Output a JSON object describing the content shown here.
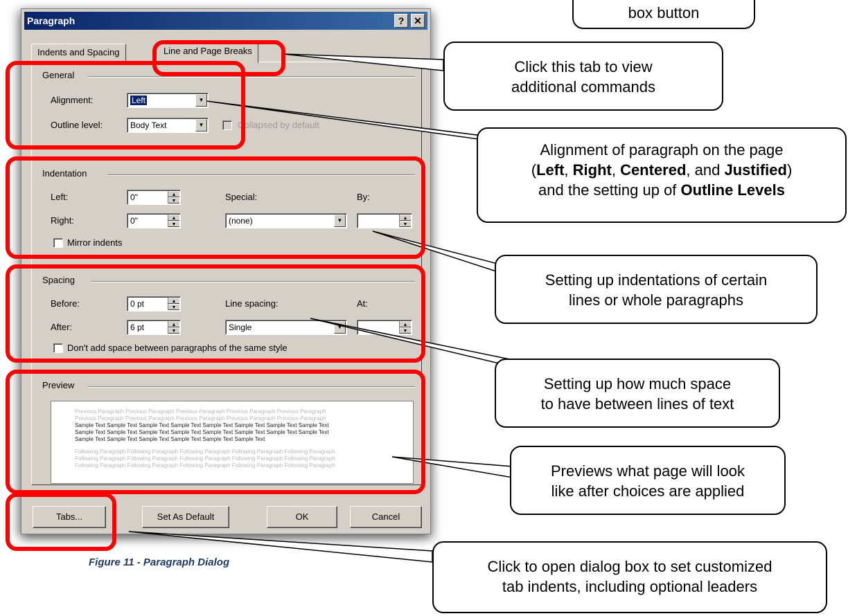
{
  "dialog": {
    "title": "Paragraph",
    "help_glyph": "?",
    "close_glyph": "✕",
    "tabs": [
      "Indents and Spacing",
      "Line and Page Breaks"
    ],
    "general": {
      "group_label": "General",
      "alignment_label": "Alignment:",
      "alignment_value": "Left",
      "outline_label": "Outline level:",
      "outline_value": "Body Text",
      "collapsed_label": "Collapsed by default"
    },
    "indentation": {
      "group_label": "Indentation",
      "left_label": "Left:",
      "left_value": "0\"",
      "right_label": "Right:",
      "right_value": "0\"",
      "special_label": "Special:",
      "special_value": "(none)",
      "by_label": "By:",
      "by_value": "",
      "mirror_label": "Mirror indents"
    },
    "spacing": {
      "group_label": "Spacing",
      "before_label": "Before:",
      "before_value": "0 pt",
      "after_label": "After:",
      "after_value": "6 pt",
      "line_spacing_label": "Line spacing:",
      "line_spacing_value": "Single",
      "at_label": "At:",
      "at_value": "",
      "dont_add_label": "Don't add space between paragraphs of the same style"
    },
    "preview": {
      "group_label": "Preview",
      "previous_lines": [
        "Previous Paragraph Previous Paragraph Previous Paragraph Previous Paragraph Previous Paragraph",
        "Previous Paragraph Previous Paragraph Previous Paragraph Previous Paragraph Previous Paragraph"
      ],
      "sample_lines": [
        "Sample Text Sample Text Sample Text Sample Text Sample Text Sample Text Sample Text Sample Text",
        "Sample Text Sample Text Sample Text Sample Text Sample Text Sample Text Sample Text Sample Text",
        "Sample Text Sample Text Sample Text Sample Text Sample Text Sample Text"
      ],
      "following_lines": [
        "Following Paragraph Following Paragraph Following Paragraph Following Paragraph Following Paragraph",
        "Following Paragraph Following Paragraph Following Paragraph Following Paragraph Following Paragraph",
        "Following Paragraph Following Paragraph Following Paragraph Following Paragraph Following Paragraph"
      ]
    },
    "buttons": {
      "tabs": "Tabs...",
      "set_default": "Set As Default",
      "ok": "OK",
      "cancel": "Cancel"
    }
  },
  "callouts": {
    "top": "box button",
    "tab_note": [
      "Click this tab to view",
      "additional commands"
    ],
    "alignment_note": {
      "line1": "Alignment of paragraph on the page",
      "open": "(",
      "left": "Left",
      "sep1": ", ",
      "right": "Right",
      "sep2": ", ",
      "centered": "Centered",
      "sep3": ", and ",
      "justified": "Justified",
      "close": ")",
      "line3_prefix": "and the setting up of ",
      "outline": "Outline Levels"
    },
    "indent_note": [
      "Setting up indentations of certain",
      "lines or whole paragraphs"
    ],
    "spacing_note": [
      "Setting up how much space",
      "to have between lines of text"
    ],
    "preview_note": [
      "Previews what page will look",
      "like after choices are applied"
    ],
    "tabs_note": [
      "Click to open dialog box to set customized",
      "tab indents, including optional leaders"
    ]
  },
  "caption": "Figure 11 - Paragraph Dialog",
  "colors": {
    "highlight": "#ff0000",
    "titlebar": "#0a246a",
    "dialog_bg": "#d4d0c8"
  }
}
